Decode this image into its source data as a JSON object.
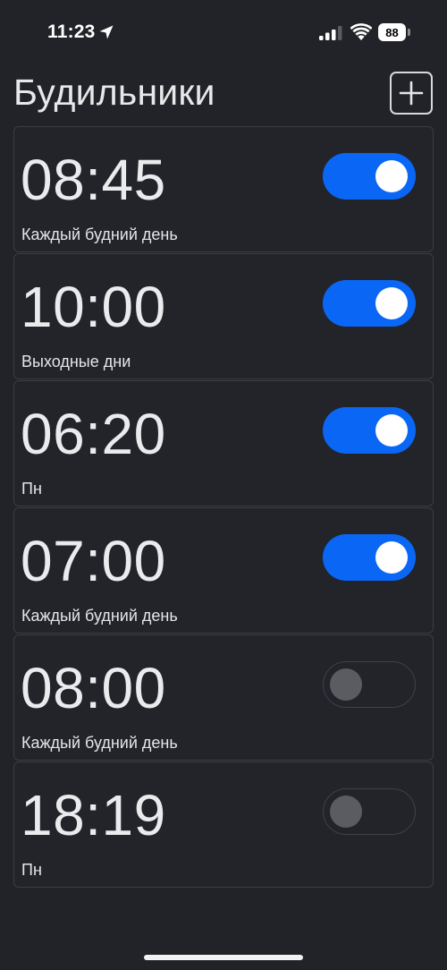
{
  "status_bar": {
    "time": "11:23",
    "battery": "88"
  },
  "header": {
    "title": "Будильники",
    "add_icon": "plus-square-icon"
  },
  "colors": {
    "background": "#212328",
    "toggle_on": "#0a67f5",
    "toggle_off_knob": "#5b5c62"
  },
  "alarms": [
    {
      "time": "08:45",
      "days": "Каждый будний день",
      "enabled": true
    },
    {
      "time": "10:00",
      "days": "Выходные дни",
      "enabled": true
    },
    {
      "time": "06:20",
      "days": "Пн",
      "enabled": true
    },
    {
      "time": "07:00",
      "days": "Каждый будний день",
      "enabled": true
    },
    {
      "time": "08:00",
      "days": "Каждый будний день",
      "enabled": false
    },
    {
      "time": "18:19",
      "days": "Пн",
      "enabled": false
    }
  ]
}
